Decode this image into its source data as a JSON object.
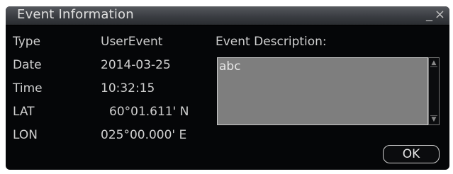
{
  "dialog": {
    "title": "Event Information",
    "minimize_label": "_",
    "close_label": "×"
  },
  "fields": {
    "type_label": "Type",
    "type_value": "UserEvent",
    "date_label": "Date",
    "date_value": "2014-03-25",
    "time_label": "Time",
    "time_value": "10:32:15",
    "lat_label": "LAT",
    "lat_value": "60°01.611' N",
    "lon_label": "LON",
    "lon_value": "025°00.000' E"
  },
  "description": {
    "label": "Event Description:",
    "text": "abc"
  },
  "buttons": {
    "ok_label": "OK"
  },
  "scrollbar": {
    "up_icon": "▲",
    "down_icon": "▼"
  }
}
